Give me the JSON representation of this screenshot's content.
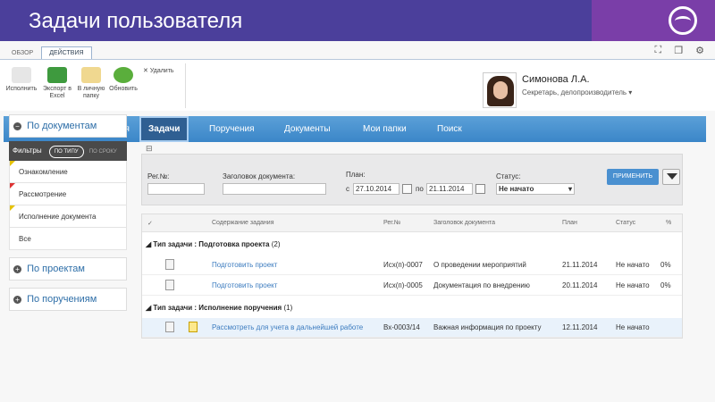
{
  "slide": {
    "title": "Задачи пользователя"
  },
  "tabs": [
    "ОБЗОР",
    "ДЕЙСТВИЯ"
  ],
  "ribbon": {
    "buttons": [
      {
        "label": "Исполнить",
        "icon": "execute-icon"
      },
      {
        "label": "Экспорт в Excel",
        "icon": "excel-icon"
      },
      {
        "label": "В личную папку",
        "icon": "folder-icon"
      },
      {
        "label": "Обновить",
        "icon": "refresh-icon"
      }
    ],
    "delete_label": "Удалить"
  },
  "user": {
    "name": "Симонова Л.А.",
    "role": "Секретарь, делопроизводитель"
  },
  "nav": [
    "Рабочий стол пользователя",
    "Задачи",
    "Поручения",
    "Документы",
    "Мои папки",
    "Поиск"
  ],
  "sidebar": {
    "by_docs": "По документам",
    "filters_label": "Фильтры",
    "by_type": "ПО ТИПУ",
    "by_deadline": "ПО СРОКУ",
    "items": [
      "Ознакомление",
      "Рассмотрение",
      "Исполнение документа",
      "Все"
    ],
    "by_projects": "По проектам",
    "by_orders": "По поручениям"
  },
  "filter": {
    "reg_label": "Рег.№:",
    "title_label": "Заголовок документа:",
    "plan_label": "План:",
    "from_label": "с",
    "from_value": "27.10.2014",
    "to_label": "по",
    "to_value": "21.11.2014",
    "status_label": "Статус:",
    "status_value": "Не начато",
    "apply_label": "ПРИМЕНИТЬ"
  },
  "grid": {
    "columns": [
      "✓",
      "Содержание задания",
      "Рег.№",
      "Заголовок документа",
      "План",
      "Статус",
      "%"
    ],
    "groups": [
      {
        "label": "Тип задачи : Подготовка проекта",
        "count": "(2)",
        "rows": [
          {
            "task": "Подготовить проект",
            "reg": "Исх(п)-0007",
            "doc": "О проведении мероприятий",
            "plan": "21.11.2014",
            "status": "Не начато",
            "pct": "0%"
          },
          {
            "task": "Подготовить проект",
            "reg": "Исх(п)-0005",
            "doc": "Документация по внедрению",
            "plan": "20.11.2014",
            "status": "Не начато",
            "pct": "0%"
          }
        ]
      },
      {
        "label": "Тип задачи : Исполнение поручения",
        "count": "(1)",
        "rows": [
          {
            "task": "Рассмотреть для учета в дальнейшей работе",
            "reg": "Вх-0003/14",
            "doc": "Важная информация по проекту",
            "plan": "12.11.2014",
            "status": "Не начато",
            "pct": ""
          }
        ]
      }
    ]
  }
}
